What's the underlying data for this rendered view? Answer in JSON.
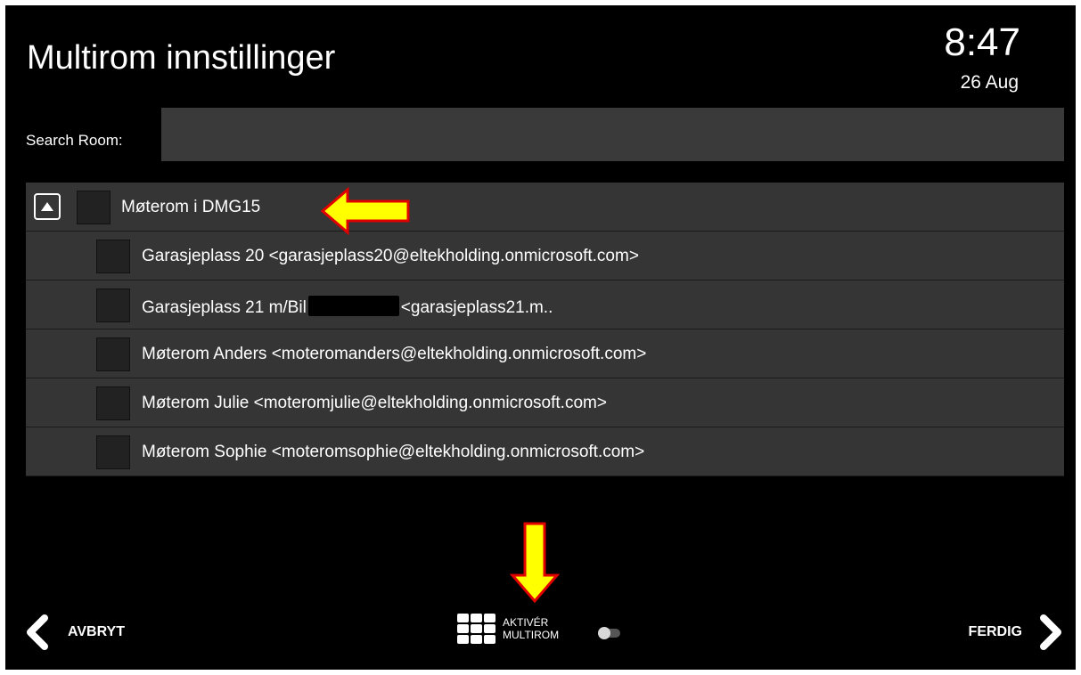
{
  "header": {
    "title": "Multirom innstillinger",
    "time": "8:47",
    "date": "26 Aug"
  },
  "search": {
    "label": "Search Room:",
    "value": "",
    "placeholder": ""
  },
  "group": {
    "label": "Møterom i DMG15",
    "expanded": true
  },
  "rooms": [
    {
      "label": "Garasjeplass 20 <garasjeplass20@eltekholding.onmicrosoft.com>"
    },
    {
      "label_prefix": "Garasjeplass 21 m/Bil",
      "label_suffix": "<garasjeplass21.m.."
    },
    {
      "label": "Møterom Anders <moteromanders@eltekholding.onmicrosoft.com>"
    },
    {
      "label": "Møterom Julie <moteromjulie@eltekholding.onmicrosoft.com>"
    },
    {
      "label": "Møterom Sophie <moteromsophie@eltekholding.onmicrosoft.com>"
    }
  ],
  "footer": {
    "back_label": "AVBRYT",
    "done_label": "FERDIG",
    "multiroom_line1": "AKTIVÉR",
    "multiroom_line2": "MULTIROM",
    "multiroom_enabled": false
  },
  "colors": {
    "background": "#000000",
    "row": "#353535",
    "search_field": "#3a3a3a",
    "annotation_arrow": "#ffff00",
    "annotation_arrow_outline": "#e00000"
  },
  "icons": {
    "expand": "chevron-up-icon",
    "back": "chevron-left-icon",
    "done": "chevron-right-icon",
    "multiroom": "grid-icon"
  }
}
